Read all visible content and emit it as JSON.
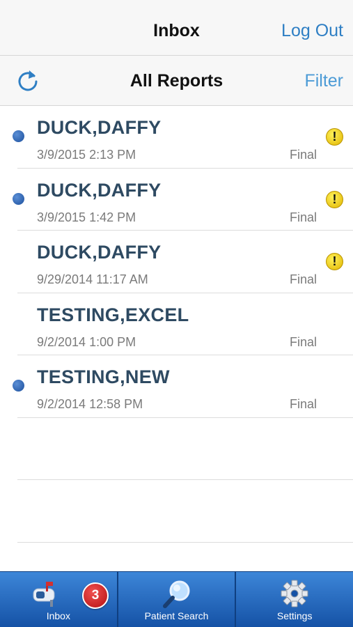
{
  "nav": {
    "title": "Inbox",
    "logout_label": "Log Out"
  },
  "toolbar": {
    "title": "All Reports",
    "filter_label": "Filter",
    "refresh_icon": "refresh-icon"
  },
  "reports": [
    {
      "name": "DUCK,DAFFY",
      "datetime": "3/9/2015 2:13 PM",
      "status": "Final",
      "unread": true,
      "alert": true
    },
    {
      "name": "DUCK,DAFFY",
      "datetime": "3/9/2015 1:42 PM",
      "status": "Final",
      "unread": true,
      "alert": true
    },
    {
      "name": "DUCK,DAFFY",
      "datetime": "9/29/2014 11:17 AM",
      "status": "Final",
      "unread": false,
      "alert": true
    },
    {
      "name": "TESTING,EXCEL",
      "datetime": "9/2/2014 1:00 PM",
      "status": "Final",
      "unread": false,
      "alert": false
    },
    {
      "name": "TESTING,NEW",
      "datetime": "9/2/2014 12:58 PM",
      "status": "Final",
      "unread": true,
      "alert": false
    }
  ],
  "alert_glyph": "!",
  "tabs": [
    {
      "label": "Inbox",
      "icon": "mailbox-icon",
      "badge": "3"
    },
    {
      "label": "Patient Search",
      "icon": "magnifier-icon"
    },
    {
      "label": "Settings",
      "icon": "gear-icon"
    }
  ],
  "colors": {
    "accent": "#2f7fc4",
    "tab_bar": "#1552a6",
    "badge": "#d42020",
    "unread_dot": "#1c4f9c",
    "alert": "#f0d000"
  }
}
